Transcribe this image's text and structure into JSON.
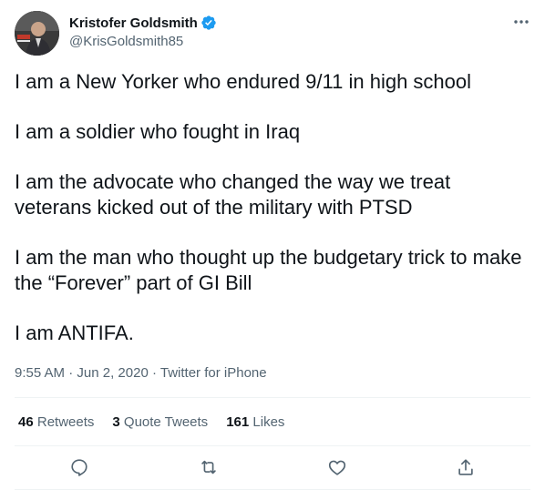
{
  "author": {
    "display_name": "Kristofer Goldsmith",
    "handle": "@KrisGoldsmith85",
    "verified_icon": "verified-badge-icon"
  },
  "tweet": {
    "paragraphs": [
      "I am a New Yorker who endured 9/11 in high school",
      "I am a soldier who fought in Iraq",
      "I am the advocate who changed the way we treat veterans kicked out of the military with PTSD",
      "I am the man who thought up the budgetary trick to make the “Forever” part of GI Bill",
      "I am ANTIFA."
    ],
    "time": "9:55 AM",
    "separator": "·",
    "date": "Jun 2, 2020",
    "source": "Twitter for iPhone"
  },
  "stats": {
    "retweets_count": "46",
    "retweets_label": "Retweets",
    "quotes_count": "3",
    "quotes_label": "Quote Tweets",
    "likes_count": "161",
    "likes_label": "Likes"
  },
  "colors": {
    "text": "#0f1419",
    "secondary": "#536471",
    "verified": "#1d9bf0",
    "divider": "#eff3f4"
  }
}
